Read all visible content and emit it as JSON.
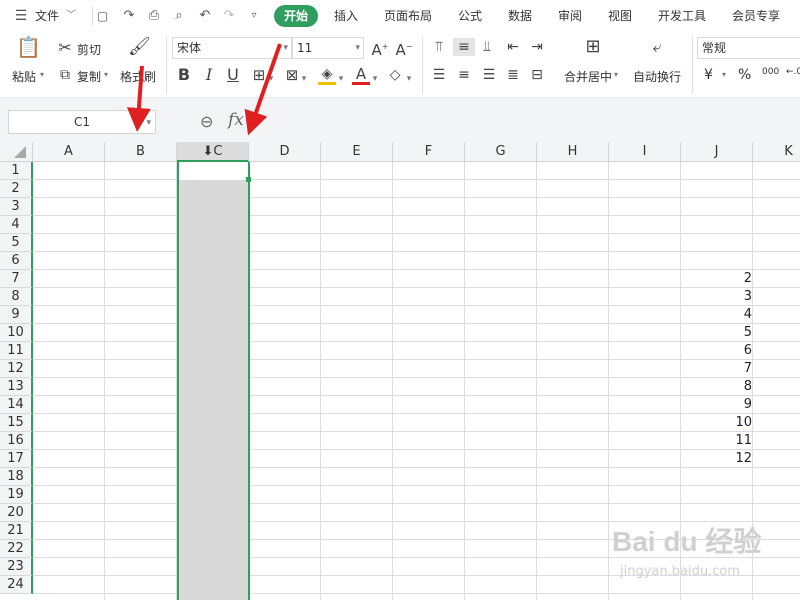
{
  "menu": {
    "file": "文件",
    "tabs": [
      "开始",
      "插入",
      "页面布局",
      "公式",
      "数据",
      "审阅",
      "视图",
      "开发工具",
      "会员专享"
    ]
  },
  "ribbon": {
    "paste": "粘贴",
    "cut": "剪切",
    "copy": "复制",
    "format_painter": "格式刷",
    "font_name": "宋体",
    "font_size": "11",
    "merge_center": "合并居中",
    "wrap_text": "自动换行",
    "number_format": "常规",
    "currency": "¥",
    "percent": "%",
    "thousands": "000"
  },
  "formula_bar": {
    "name_box": "C1",
    "fx": "fx"
  },
  "sheet": {
    "columns": [
      "A",
      "B",
      "C",
      "D",
      "E",
      "F",
      "G",
      "H",
      "I",
      "J",
      "K"
    ],
    "selected_column": "C",
    "rows": [
      "1",
      "2",
      "3",
      "4",
      "5",
      "6",
      "7",
      "8",
      "9",
      "10",
      "11",
      "12",
      "13",
      "14",
      "15",
      "16",
      "17",
      "18",
      "19",
      "20",
      "21",
      "22",
      "23",
      "24"
    ],
    "column_j_values": [
      {
        "row": 7,
        "value": "2"
      },
      {
        "row": 8,
        "value": "3"
      },
      {
        "row": 9,
        "value": "4"
      },
      {
        "row": 10,
        "value": "5"
      },
      {
        "row": 11,
        "value": "6"
      },
      {
        "row": 12,
        "value": "7"
      },
      {
        "row": 13,
        "value": "8"
      },
      {
        "row": 14,
        "value": "9"
      },
      {
        "row": 15,
        "value": "10"
      },
      {
        "row": 16,
        "value": "11"
      },
      {
        "row": 17,
        "value": "12"
      }
    ]
  },
  "watermark": {
    "brand": "Bai du 经验",
    "url": "jingyan.baidu.com"
  },
  "colors": {
    "accent": "#2f9e5f",
    "arrow": "#e02020"
  }
}
